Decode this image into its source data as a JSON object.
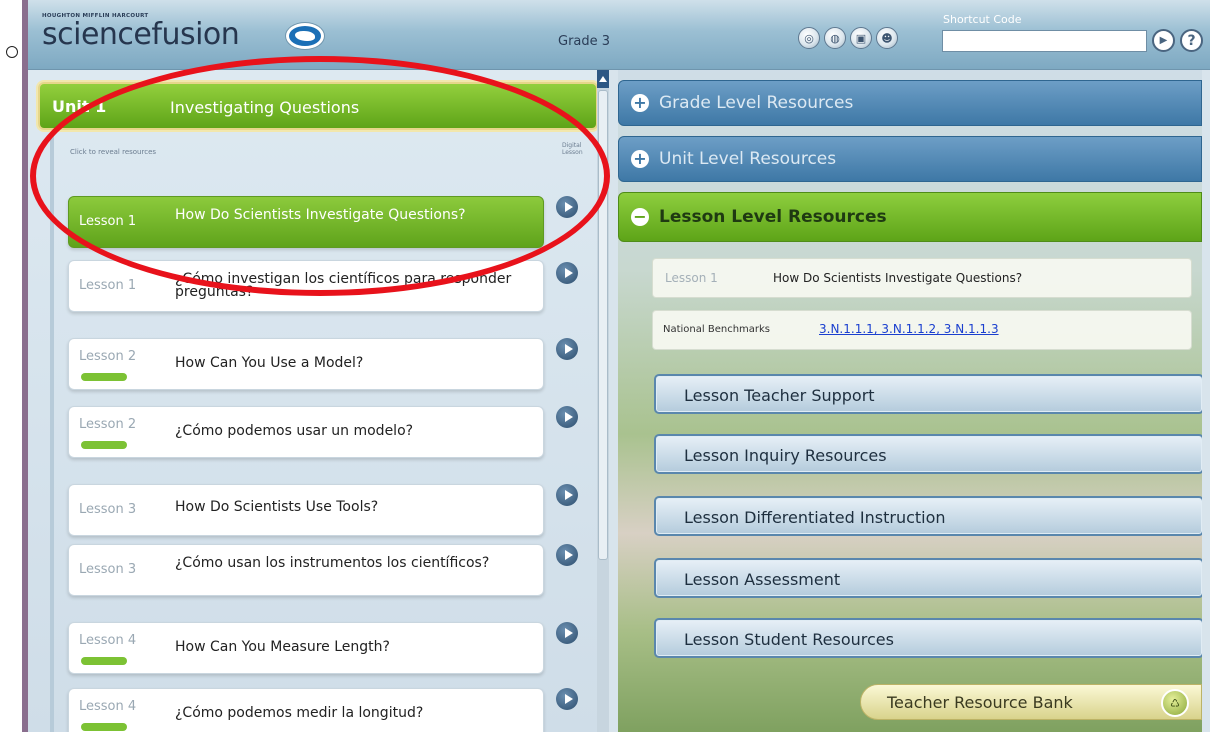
{
  "header": {
    "publisher": "HOUGHTON MIFFLIN HARCOURT",
    "brand": "sciencefusion",
    "grade": "Grade 3",
    "shortcut_label": "Shortcut Code",
    "shortcut_value": "",
    "icons": [
      "globe-icon",
      "world-icon",
      "print-icon",
      "person-icon"
    ],
    "go_icon": "play-icon",
    "help_glyph": "?"
  },
  "unit": {
    "number": "Unit 1",
    "title": "Investigating Questions",
    "reveal_hint": "Click to reveal resources",
    "digital_lesson_header": "Digital Lesson"
  },
  "lessons": [
    {
      "label": "Lesson 1",
      "title": "How Do Scientists Investigate Questions?",
      "active": true,
      "tag": false
    },
    {
      "label": "Lesson 1",
      "title": "¿Cómo investigan los científicos para responder preguntas?",
      "active": false,
      "tag": false
    },
    {
      "label": "Lesson 2",
      "title": "How Can You Use a Model?",
      "active": false,
      "tag": true
    },
    {
      "label": "Lesson 2",
      "title": "¿Cómo podemos usar un modelo?",
      "active": false,
      "tag": true
    },
    {
      "label": "Lesson 3",
      "title": "How Do Scientists Use Tools?",
      "active": false,
      "tag": false
    },
    {
      "label": "Lesson 3",
      "title": "¿Cómo usan los instrumentos los científicos?",
      "active": false,
      "tag": false
    },
    {
      "label": "Lesson 4",
      "title": "How Can You Measure Length?",
      "active": false,
      "tag": true
    },
    {
      "label": "Lesson 4",
      "title": "¿Cómo podemos medir la longitud?",
      "active": false,
      "tag": true
    }
  ],
  "resources": {
    "grade_level": "Grade Level Resources",
    "unit_level": "Unit Level Resources",
    "lesson_level": "Lesson Level Resources",
    "current_lesson_label": "Lesson 1",
    "current_lesson_title": "How Do Scientists Investigate Questions?",
    "benchmarks_label": "National Benchmarks",
    "benchmarks_links": "3.N.1.1.1, 3.N.1.1.2, 3.N.1.1.3",
    "buttons": [
      "Lesson Teacher Support",
      "Lesson Inquiry Resources",
      "Lesson Differentiated Instruction",
      "Lesson Assessment",
      "Lesson Student Resources"
    ],
    "teacher_resource_bank": "Teacher Resource Bank"
  },
  "colors": {
    "active_green": "#5ea418",
    "accordion_blue": "#3e78a6",
    "annotation_red": "#e8121b"
  }
}
